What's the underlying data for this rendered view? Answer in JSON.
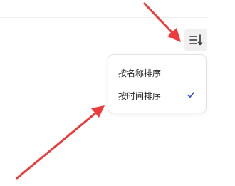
{
  "toolbar": {
    "sort_icon": "sort-lines-arrow-icon"
  },
  "sort_menu": {
    "items": [
      {
        "label": "按名称排序",
        "selected": false
      },
      {
        "label": "按时间排序",
        "selected": true
      }
    ],
    "check_icon": "checkmark-icon"
  },
  "colors": {
    "arrow": "#ee3a3a",
    "check": "#3b4fd1",
    "button_bg": "#f0f0f0",
    "menu_border": "#e2e2e2"
  }
}
